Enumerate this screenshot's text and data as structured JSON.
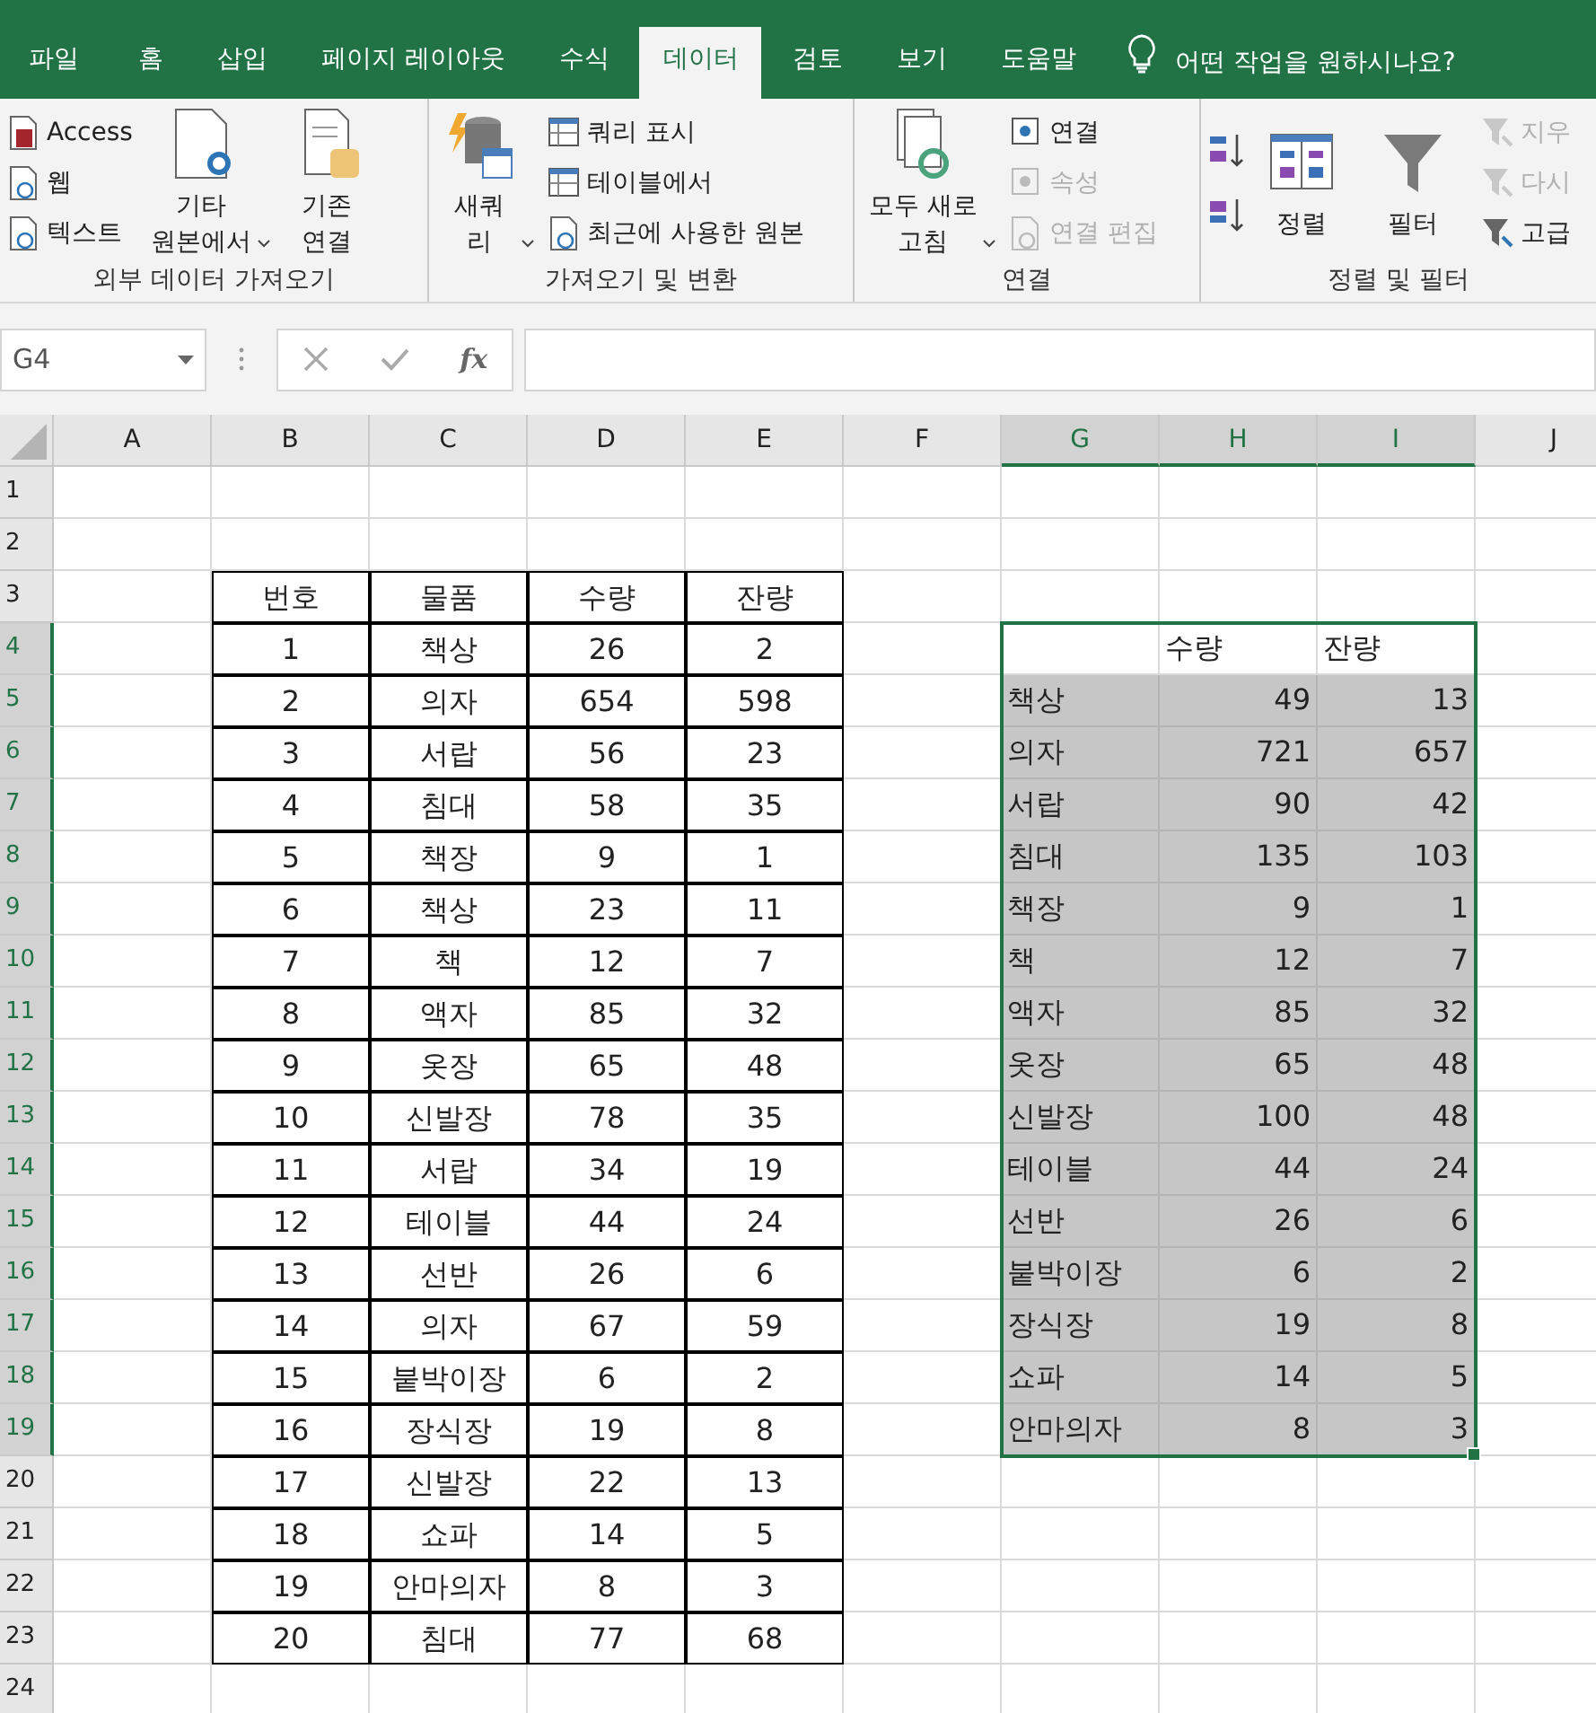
{
  "tabs": [
    {
      "label": "파일",
      "selected": false
    },
    {
      "label": "홈",
      "selected": false
    },
    {
      "label": "삽입",
      "selected": false
    },
    {
      "label": "페이지 레이아웃",
      "selected": false
    },
    {
      "label": "수식",
      "selected": false
    },
    {
      "label": "데이터",
      "selected": true
    },
    {
      "label": "검토",
      "selected": false
    },
    {
      "label": "보기",
      "selected": false
    },
    {
      "label": "도움말",
      "selected": false
    }
  ],
  "tell_me": {
    "placeholder": "어떤 작업을 원하시나요?"
  },
  "ribbon_groups": [
    {
      "label": "외부 데이터 가져오기",
      "columns": [
        [
          {
            "kind": "small",
            "lines": [
              "Access"
            ],
            "disabled": false
          },
          {
            "kind": "small",
            "lines": [
              "웹"
            ],
            "disabled": false
          },
          {
            "kind": "small",
            "lines": [
              "텍스트"
            ],
            "disabled": false
          }
        ],
        [
          {
            "kind": "large",
            "lines": [
              "기타",
              "원본에서"
            ],
            "dropdown": true,
            "disabled": false
          }
        ],
        [
          {
            "kind": "large",
            "lines": [
              "기존",
              "연결"
            ],
            "disabled": false
          }
        ]
      ]
    },
    {
      "label": "가져오기 및 변환",
      "columns": [
        [
          {
            "kind": "large",
            "lines": [
              "새쿼",
              "리"
            ],
            "dropdown": true,
            "disabled": false
          }
        ],
        [
          {
            "kind": "small",
            "lines": [
              "쿼리 표시"
            ],
            "disabled": false
          },
          {
            "kind": "small",
            "lines": [
              "테이블에서"
            ],
            "disabled": false
          },
          {
            "kind": "small",
            "lines": [
              "최근에 사용한 원본"
            ],
            "disabled": false
          }
        ]
      ]
    },
    {
      "label": "연결",
      "columns": [
        [
          {
            "kind": "large",
            "lines": [
              "모두 새로",
              "고침"
            ],
            "dropdown": true,
            "disabled": false
          }
        ],
        [
          {
            "kind": "small",
            "lines": [
              "연결"
            ],
            "disabled": false
          },
          {
            "kind": "small",
            "lines": [
              "속성"
            ],
            "disabled": true
          },
          {
            "kind": "small",
            "lines": [
              "연결 편집"
            ],
            "disabled": true
          }
        ]
      ]
    },
    {
      "label": "정렬 및 필터",
      "columns": [
        [
          {
            "kind": "icon",
            "disabled": false
          },
          {
            "kind": "icon",
            "disabled": false
          }
        ],
        [
          {
            "kind": "large",
            "lines": [
              "정렬"
            ],
            "disabled": false
          }
        ],
        [
          {
            "kind": "large",
            "lines": [
              "필터"
            ],
            "disabled": false
          }
        ],
        [
          {
            "kind": "small",
            "lines": [
              "지우"
            ],
            "disabled": true
          },
          {
            "kind": "small",
            "lines": [
              "다시"
            ],
            "disabled": true
          },
          {
            "kind": "small",
            "lines": [
              "고급"
            ],
            "disabled": false
          }
        ]
      ]
    }
  ],
  "formula_bar": {
    "name_box": "G4",
    "function_label": "fx"
  },
  "columns": [
    {
      "label": "A",
      "selected": false
    },
    {
      "label": "B",
      "selected": false
    },
    {
      "label": "C",
      "selected": false
    },
    {
      "label": "D",
      "selected": false
    },
    {
      "label": "E",
      "selected": false
    },
    {
      "label": "F",
      "selected": false
    },
    {
      "label": "G",
      "selected": true
    },
    {
      "label": "H",
      "selected": true
    },
    {
      "label": "I",
      "selected": true
    },
    {
      "label": "J",
      "selected": false
    }
  ],
  "rows": [
    {
      "label": "1",
      "selected": false
    },
    {
      "label": "2",
      "selected": false
    },
    {
      "label": "3",
      "selected": false
    },
    {
      "label": "4",
      "selected": true
    },
    {
      "label": "5",
      "selected": true
    },
    {
      "label": "6",
      "selected": true
    },
    {
      "label": "7",
      "selected": true
    },
    {
      "label": "8",
      "selected": true
    },
    {
      "label": "9",
      "selected": true
    },
    {
      "label": "10",
      "selected": true
    },
    {
      "label": "11",
      "selected": true
    },
    {
      "label": "12",
      "selected": true
    },
    {
      "label": "13",
      "selected": true
    },
    {
      "label": "14",
      "selected": true
    },
    {
      "label": "15",
      "selected": true
    },
    {
      "label": "16",
      "selected": true
    },
    {
      "label": "17",
      "selected": true
    },
    {
      "label": "18",
      "selected": true
    },
    {
      "label": "19",
      "selected": true
    },
    {
      "label": "20",
      "selected": false
    },
    {
      "label": "21",
      "selected": false
    },
    {
      "label": "22",
      "selected": false
    },
    {
      "label": "23",
      "selected": false
    },
    {
      "label": "24",
      "selected": false
    }
  ],
  "left_table": {
    "columns": [
      "번호",
      "물품",
      "수량",
      "잔량"
    ],
    "rows": [
      [
        "1",
        "책상",
        "26",
        "2"
      ],
      [
        "2",
        "의자",
        "654",
        "598"
      ],
      [
        "3",
        "서랍",
        "56",
        "23"
      ],
      [
        "4",
        "침대",
        "58",
        "35"
      ],
      [
        "5",
        "책장",
        "9",
        "1"
      ],
      [
        "6",
        "책상",
        "23",
        "11"
      ],
      [
        "7",
        "책",
        "12",
        "7"
      ],
      [
        "8",
        "액자",
        "85",
        "32"
      ],
      [
        "9",
        "옷장",
        "65",
        "48"
      ],
      [
        "10",
        "신발장",
        "78",
        "35"
      ],
      [
        "11",
        "서랍",
        "34",
        "19"
      ],
      [
        "12",
        "테이블",
        "44",
        "24"
      ],
      [
        "13",
        "선반",
        "26",
        "6"
      ],
      [
        "14",
        "의자",
        "67",
        "59"
      ],
      [
        "15",
        "붙박이장",
        "6",
        "2"
      ],
      [
        "16",
        "장식장",
        "19",
        "8"
      ],
      [
        "17",
        "신발장",
        "22",
        "13"
      ],
      [
        "18",
        "쇼파",
        "14",
        "5"
      ],
      [
        "19",
        "안마의자",
        "8",
        "3"
      ],
      [
        "20",
        "침대",
        "77",
        "68"
      ]
    ]
  },
  "right_table": {
    "selected": true,
    "columns": [
      "수량",
      "잔량"
    ],
    "rows": [
      [
        "책상",
        "49",
        "13"
      ],
      [
        "의자",
        "721",
        "657"
      ],
      [
        "서랍",
        "90",
        "42"
      ],
      [
        "침대",
        "135",
        "103"
      ],
      [
        "책장",
        "9",
        "1"
      ],
      [
        "책",
        "12",
        "7"
      ],
      [
        "액자",
        "85",
        "32"
      ],
      [
        "옷장",
        "65",
        "48"
      ],
      [
        "신발장",
        "100",
        "48"
      ],
      [
        "테이블",
        "44",
        "24"
      ],
      [
        "선반",
        "26",
        "6"
      ],
      [
        "붙박이장",
        "6",
        "2"
      ],
      [
        "장식장",
        "19",
        "8"
      ],
      [
        "쇼파",
        "14",
        "5"
      ],
      [
        "안마의자",
        "8",
        "3"
      ]
    ]
  }
}
